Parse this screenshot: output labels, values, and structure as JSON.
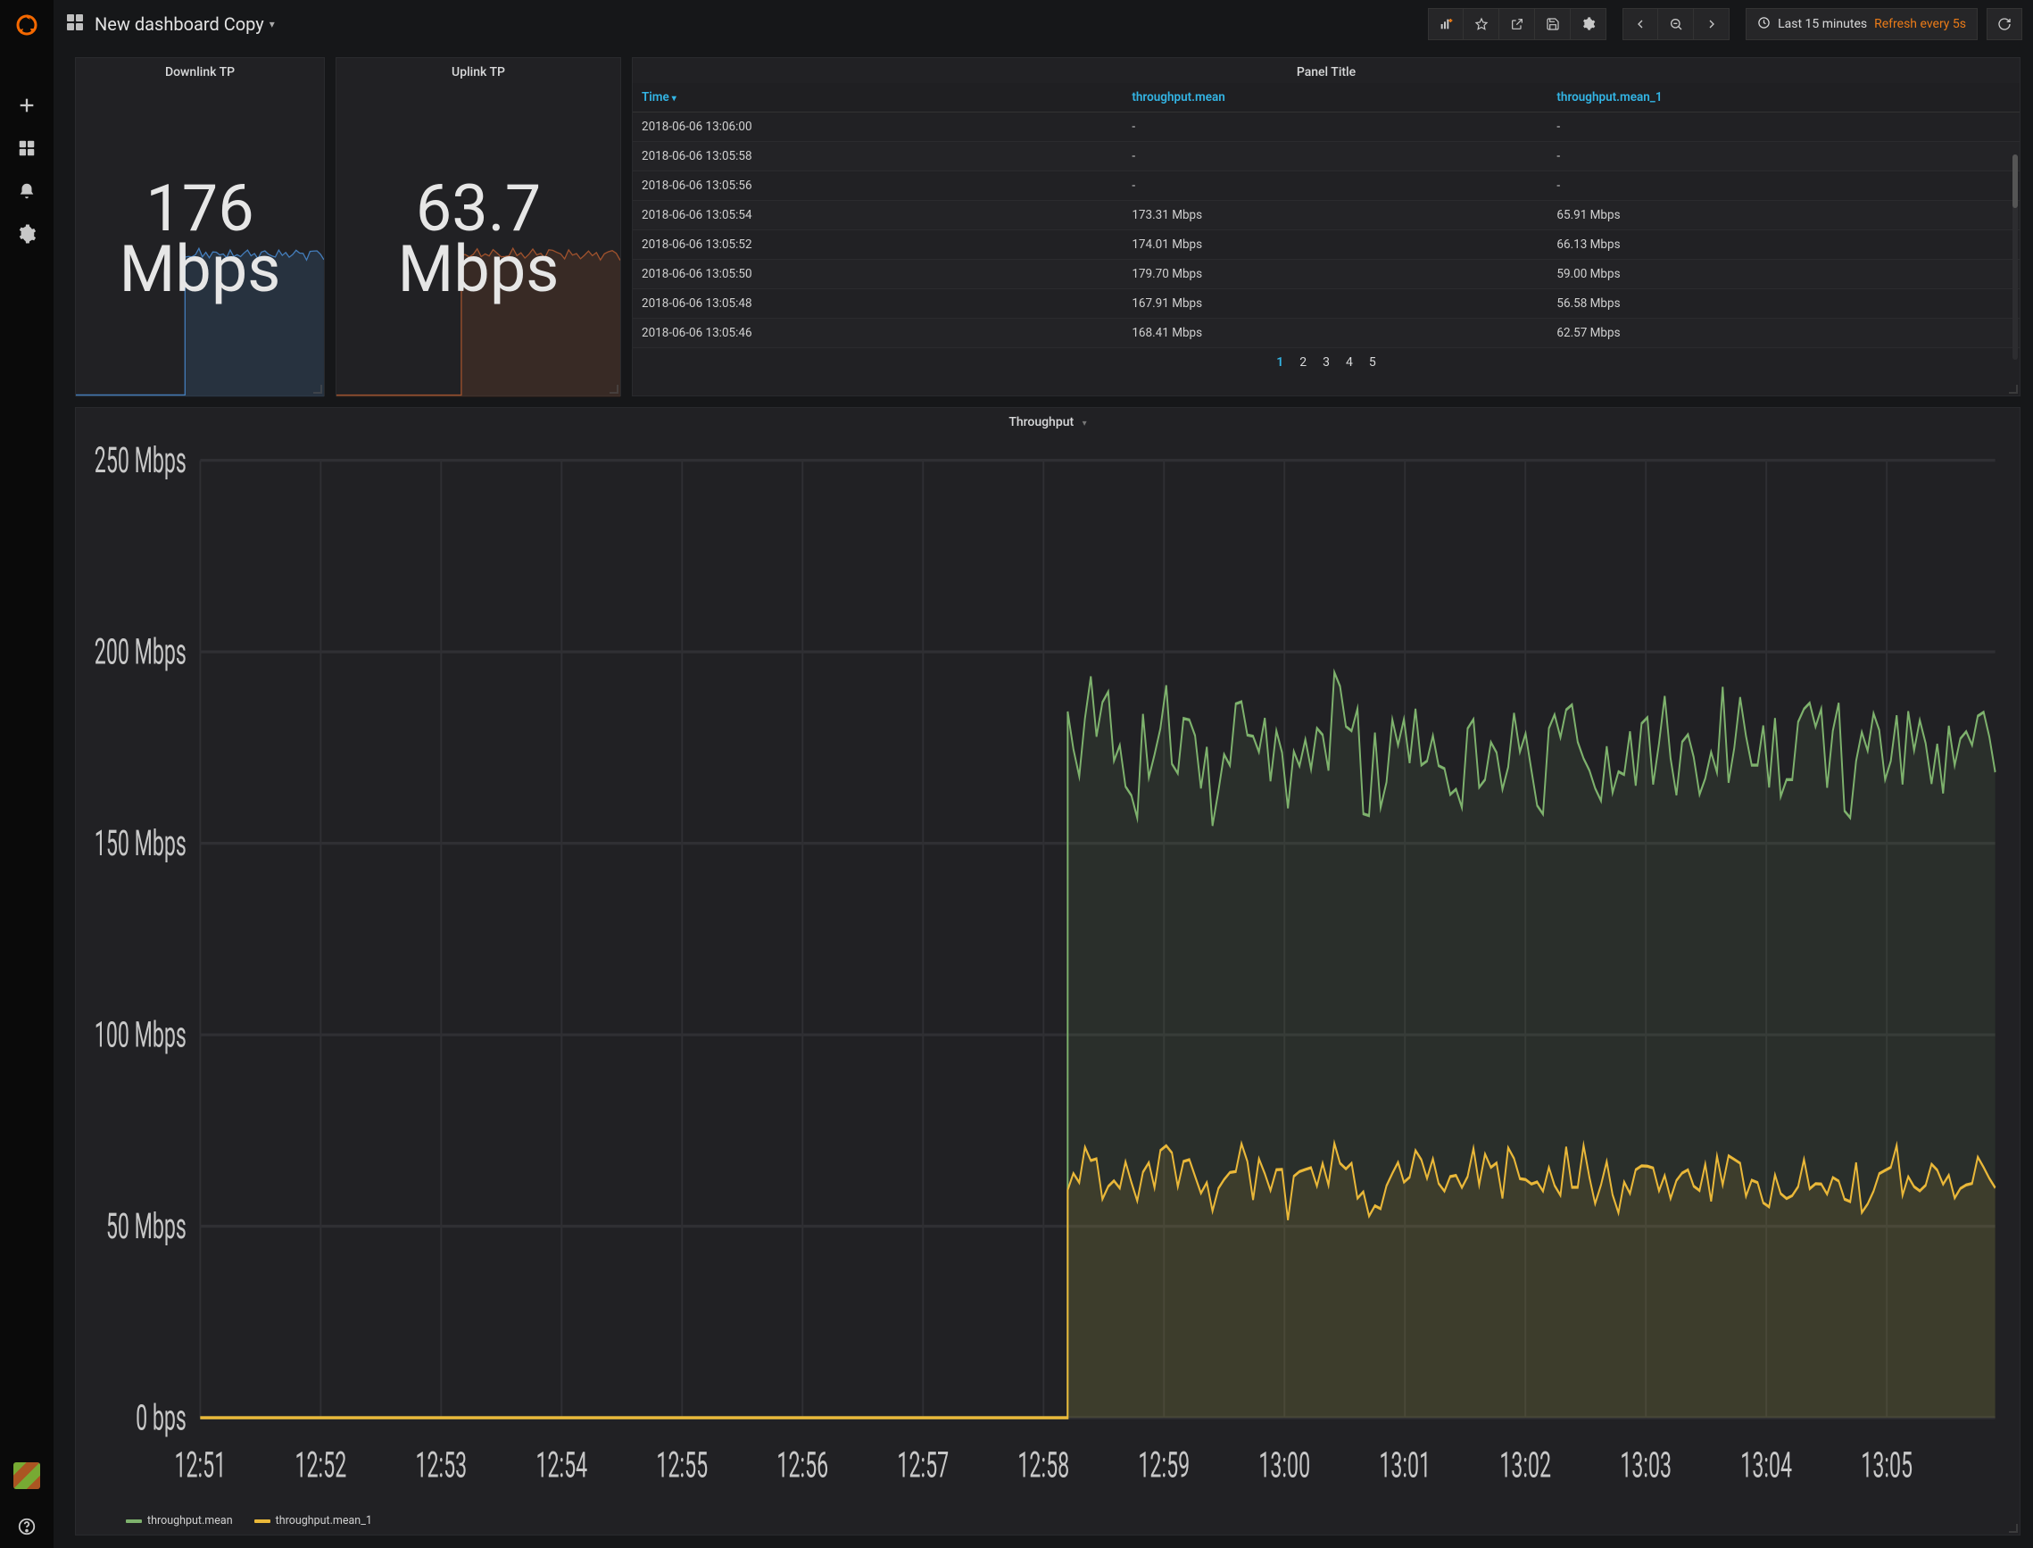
{
  "header": {
    "title": "New dashboard Copy",
    "time_range": "Last 15 minutes",
    "refresh": "Refresh every 5s"
  },
  "panels": {
    "downlink": {
      "title": "Downlink TP",
      "value": "176",
      "unit": "Mbps",
      "color": "#447ebc"
    },
    "uplink": {
      "title": "Uplink TP",
      "value": "63.7",
      "unit": "Mbps",
      "color": "#a0522d"
    },
    "table": {
      "title": "Panel Title",
      "columns": [
        "Time",
        "throughput.mean",
        "throughput.mean_1"
      ],
      "rows": [
        {
          "t": "2018-06-06 13:06:00",
          "a": "-",
          "b": "-"
        },
        {
          "t": "2018-06-06 13:05:58",
          "a": "-",
          "b": "-"
        },
        {
          "t": "2018-06-06 13:05:56",
          "a": "-",
          "b": "-"
        },
        {
          "t": "2018-06-06 13:05:54",
          "a": "173.31 Mbps",
          "b": "65.91 Mbps"
        },
        {
          "t": "2018-06-06 13:05:52",
          "a": "174.01 Mbps",
          "b": "66.13 Mbps"
        },
        {
          "t": "2018-06-06 13:05:50",
          "a": "179.70 Mbps",
          "b": "59.00 Mbps"
        },
        {
          "t": "2018-06-06 13:05:48",
          "a": "167.91 Mbps",
          "b": "56.58 Mbps"
        },
        {
          "t": "2018-06-06 13:05:46",
          "a": "168.41 Mbps",
          "b": "62.57 Mbps"
        }
      ],
      "pages": [
        "1",
        "2",
        "3",
        "4",
        "5"
      ],
      "active_page": "1"
    },
    "graph": {
      "title": "Throughput",
      "legend": [
        {
          "label": "throughput.mean",
          "color": "#7eb26d"
        },
        {
          "label": "throughput.mean_1",
          "color": "#eab839"
        }
      ]
    }
  },
  "chart_data": {
    "type": "line",
    "title": "Throughput",
    "xlabel": "",
    "ylabel": "",
    "ylim": [
      0,
      250
    ],
    "y_ticks": [
      "0 bps",
      "50 Mbps",
      "100 Mbps",
      "150 Mbps",
      "200 Mbps",
      "250 Mbps"
    ],
    "x_ticks": [
      "12:51",
      "12:52",
      "12:53",
      "12:54",
      "12:55",
      "12:56",
      "12:57",
      "12:58",
      "12:59",
      "13:00",
      "13:01",
      "13:02",
      "13:03",
      "13:04",
      "13:05"
    ],
    "step_at": "12:58",
    "series": [
      {
        "name": "throughput.mean",
        "color": "#7eb26d",
        "pre_value": 0,
        "post_mean": 175,
        "post_jitter": 25
      },
      {
        "name": "throughput.mean_1",
        "color": "#eab839",
        "pre_value": 0,
        "post_mean": 62,
        "post_jitter": 12
      }
    ]
  }
}
